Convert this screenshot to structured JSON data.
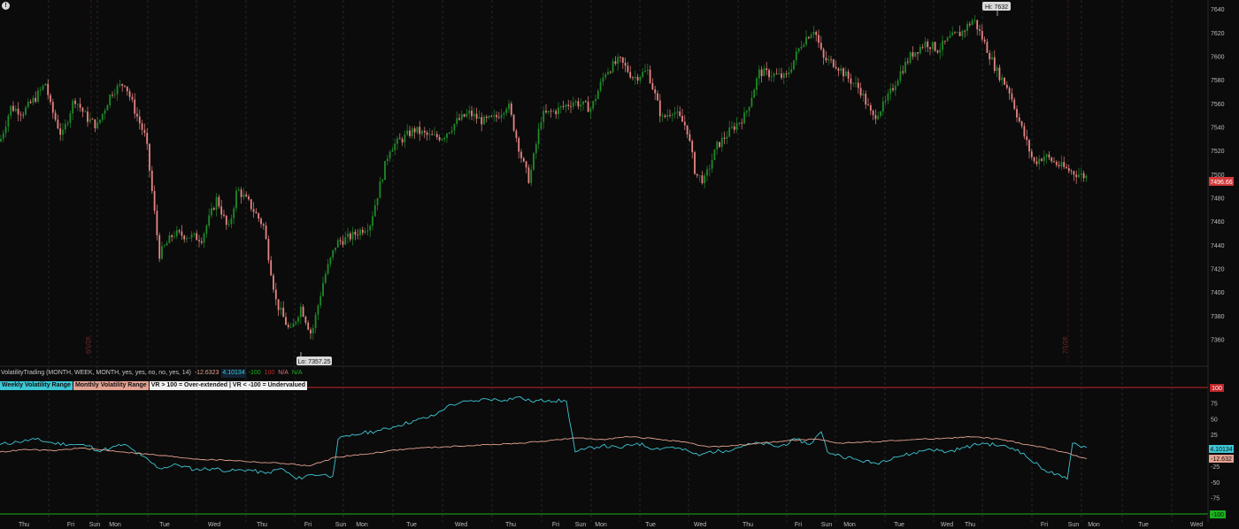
{
  "colors": {
    "background": "#0b0b0b",
    "up_candle": "#1f8a2a",
    "down_candle": "#e88484",
    "weekly_line": "#3ec6d4",
    "monthly_line": "#e4a292",
    "overbought_line": "#c0262a",
    "oversold_line": "#19b21e",
    "grid": "#3a3a3a"
  },
  "price_panel": {
    "hi_label": "Hi: 7632",
    "lo_label": "Lo: 7357.25",
    "last_price_label": "7496.66",
    "y_ticks": [
      "7640",
      "7620",
      "7600",
      "7580",
      "7560",
      "7540",
      "7520",
      "7500",
      "7480",
      "7460",
      "7440",
      "7420",
      "7400",
      "7380",
      "7360"
    ],
    "left_marker": "6/1/26",
    "right_marker": "7/1/26"
  },
  "indicator": {
    "study_label": "VolatilityTrading (MONTH, WEEK, MONTH, yes, yes, no, no, yes, 14)",
    "values": [
      "-12.6323",
      "4.10134",
      "-100",
      "100",
      "N/A",
      "N/A"
    ],
    "pills": {
      "weekly": "Weekly Volatility Range",
      "monthly": "Monthly Volatility Range",
      "note": "VR > 100 = Over-extended | VR < -100 = Undervalued"
    },
    "y_ticks": [
      "75",
      "50",
      "25",
      "0",
      "-25",
      "-50",
      "-75"
    ],
    "upper_label": "100",
    "lower_label": "-100",
    "weekly_value_label": "4.10134",
    "monthly_value_label": "-12.632"
  },
  "x_labels": [
    "Thu",
    "Fri",
    "Sun",
    "Mon",
    "Tue",
    "Wed",
    "Thu",
    "Fri",
    "Sun",
    "Mon",
    "Tue",
    "Wed",
    "Thu",
    "Fri",
    "Sun",
    "Mon",
    "Tue",
    "Wed",
    "Thu",
    "Fri",
    "Sun",
    "Mon",
    "Tue",
    "Wed",
    "Thu",
    "Fri",
    "Sun",
    "Mon",
    "Tue",
    "Wed"
  ],
  "chart_data": [
    {
      "type": "line",
      "title": "",
      "description_series": "price",
      "ylim": [
        7348,
        7645
      ],
      "series": [
        {
          "x": [
            0,
            12,
            26,
            40,
            52,
            56,
            70,
            84,
            98,
            110,
            126,
            141,
            152,
            165,
            180,
            196,
            212,
            228,
            245,
            258,
            268,
            282,
            298,
            312,
            328,
            340,
            352,
            366,
            380,
            398,
            418,
            440,
            468,
            486,
            500,
            516,
            530,
            546,
            560,
            574,
            590,
            598,
            612,
            628,
            648,
            668,
            684,
            700,
            716,
            732,
            748,
            760,
            776,
            786,
            796,
            810,
            826,
            842,
            858,
            872,
            888,
            906,
            920,
            930,
            944,
            958,
            972,
            986,
            1000,
            1016,
            1030,
            1046,
            1060,
            1074,
            1086,
            1100,
            1112,
            1126,
            1140,
            1154,
            1168,
            1180,
            1196,
            1212,
            1228
          ],
          "values": [
            7528,
            7557,
            7553,
            7565,
            7578,
            7560,
            7532,
            7565,
            7548,
            7541,
            7570,
            7578,
            7555,
            7530,
            7432,
            7450,
            7448,
            7446,
            7480,
            7452,
            7488,
            7475,
            7456,
            7392,
            7366,
            7388,
            7364,
            7412,
            7442,
            7448,
            7458,
            7522,
            7538,
            7532,
            7532,
            7545,
            7552,
            7545,
            7548,
            7560,
            7512,
            7495,
            7550,
            7554,
            7562,
            7556,
            7587,
            7597,
            7582,
            7588,
            7547,
            7555,
            7540,
            7500,
            7495,
            7524,
            7538,
            7550,
            7587,
            7585,
            7582,
            7612,
            7624,
            7598,
            7594,
            7582,
            7572,
            7548,
            7560,
            7585,
            7602,
            7612,
            7606,
            7616,
            7620,
            7632,
            7612,
            7588,
            7572,
            7540,
            7510,
            7516,
            7508,
            7502,
            7498
          ]
        }
      ]
    },
    {
      "type": "line",
      "title": "",
      "ylim": [
        -100,
        100
      ],
      "series": [
        {
          "name": "Weekly Volatility Range",
          "x": [
            0,
            20,
            40,
            60,
            80,
            100,
            110,
            125,
            140,
            160,
            180,
            200,
            220,
            240,
            260,
            280,
            300,
            318,
            335,
            350,
            365,
            376,
            382,
            395,
            410,
            430,
            450,
            470,
            490,
            505,
            520,
            535,
            550,
            570,
            585,
            600,
            620,
            640,
            650,
            660,
            680,
            700,
            720,
            740,
            760,
            780,
            790,
            800,
            820,
            840,
            860,
            880,
            900,
            915,
            928,
            935,
            950,
            970,
            990,
            1010,
            1030,
            1050,
            1070,
            1090,
            1110,
            1130,
            1150,
            1160,
            1180,
            1200,
            1206,
            1212,
            1228
          ],
          "values": [
            10,
            14,
            18,
            12,
            10,
            8,
            0,
            4,
            10,
            -8,
            -28,
            -22,
            -30,
            -28,
            -32,
            -30,
            -36,
            -28,
            -45,
            -38,
            -38,
            -40,
            18,
            23,
            28,
            32,
            40,
            48,
            55,
            70,
            76,
            78,
            82,
            80,
            85,
            78,
            80,
            78,
            -2,
            2,
            8,
            4,
            12,
            3,
            6,
            -2,
            -8,
            -2,
            0,
            8,
            12,
            6,
            18,
            10,
            30,
            -2,
            -8,
            -15,
            -20,
            -10,
            -5,
            3,
            -2,
            5,
            12,
            8,
            2,
            -10,
            -30,
            -42,
            -45,
            12,
            5
          ]
        },
        {
          "name": "Monthly Volatility Range",
          "x": [
            0,
            30,
            60,
            90,
            110,
            140,
            170,
            200,
            230,
            260,
            290,
            320,
            350,
            380,
            410,
            440,
            470,
            500,
            530,
            560,
            590,
            620,
            650,
            680,
            710,
            740,
            770,
            800,
            830,
            860,
            890,
            920,
            950,
            980,
            1010,
            1040,
            1070,
            1100,
            1130,
            1160,
            1190,
            1228
          ],
          "values": [
            -2,
            2,
            0,
            4,
            2,
            -2,
            -6,
            -10,
            -14,
            -15,
            -18,
            -20,
            -24,
            -10,
            -6,
            0,
            4,
            6,
            8,
            10,
            12,
            16,
            20,
            18,
            22,
            19,
            14,
            6,
            8,
            12,
            16,
            18,
            12,
            14,
            16,
            18,
            20,
            22,
            18,
            10,
            2,
            -12.6
          ]
        }
      ]
    }
  ]
}
